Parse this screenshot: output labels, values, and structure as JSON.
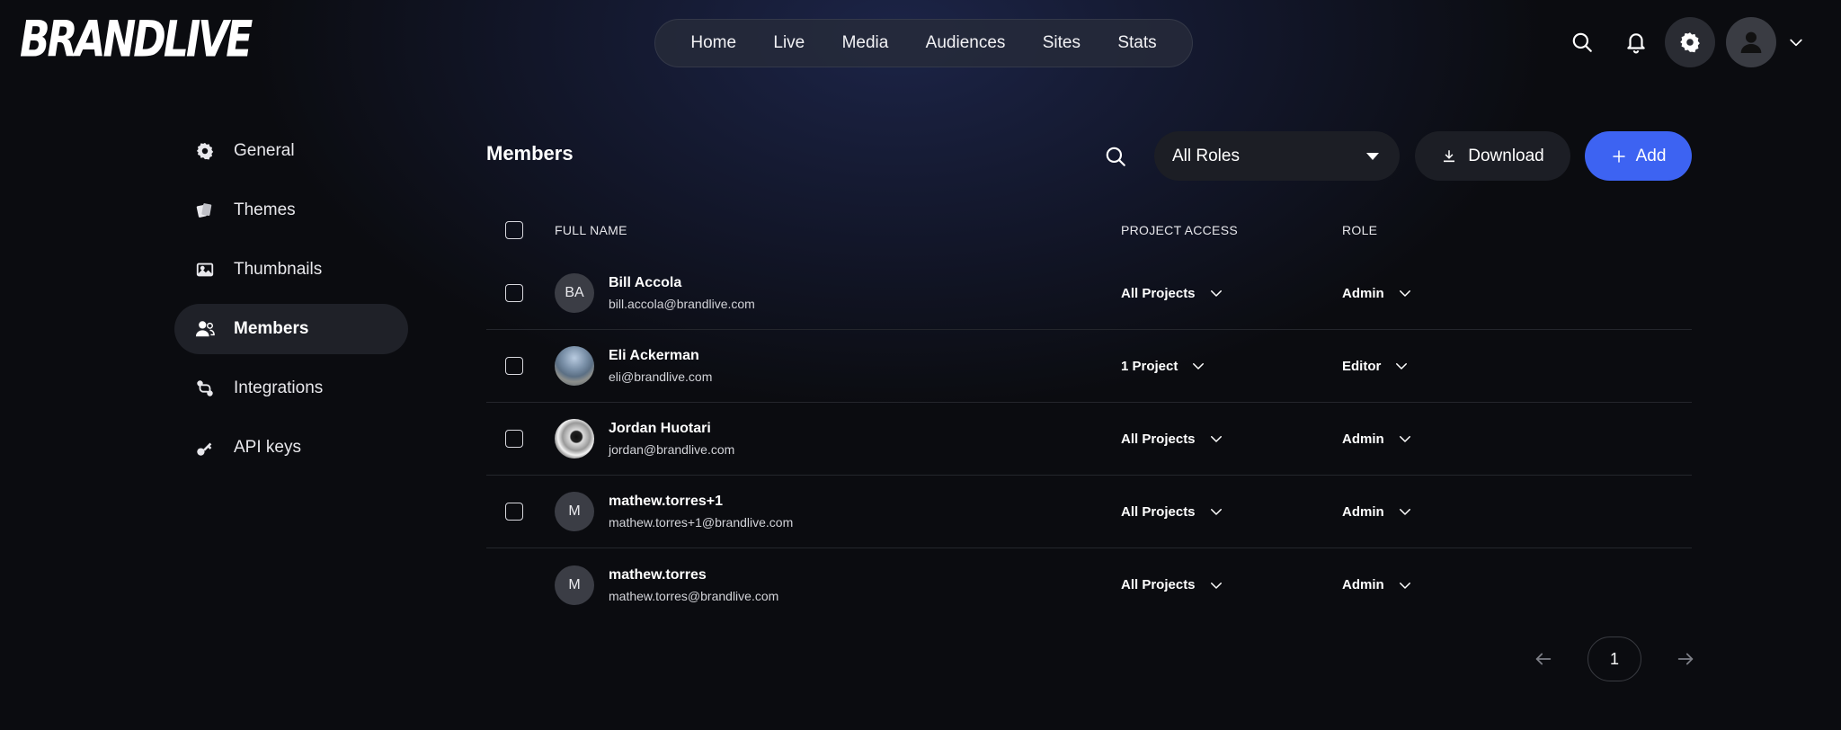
{
  "brand": {
    "logo_text": "BRANDLIVE"
  },
  "topnav": {
    "items": [
      "Home",
      "Live",
      "Media",
      "Audiences",
      "Sites",
      "Stats"
    ]
  },
  "top_actions": {
    "icons": [
      "search-icon",
      "bell-icon",
      "gear-icon",
      "user-icon",
      "chevron-down-icon"
    ]
  },
  "sidebar": {
    "items": [
      {
        "label": "General",
        "icon": "gear-icon",
        "active": false
      },
      {
        "label": "Themes",
        "icon": "cards-icon",
        "active": false
      },
      {
        "label": "Thumbnails",
        "icon": "image-icon",
        "active": false
      },
      {
        "label": "Members",
        "icon": "users-icon",
        "active": true
      },
      {
        "label": "Integrations",
        "icon": "integration-icon",
        "active": false
      },
      {
        "label": "API keys",
        "icon": "key-icon",
        "active": false
      }
    ]
  },
  "main": {
    "title": "Members",
    "roles_filter": "All Roles",
    "download_label": "Download",
    "add_label": "Add"
  },
  "table": {
    "headers": {
      "name": "FULL NAME",
      "access": "PROJECT ACCESS",
      "role": "ROLE"
    },
    "rows": [
      {
        "initials": "BA",
        "name": "Bill Accola",
        "email": "bill.accola@brandlive.com",
        "access": "All Projects",
        "role": "Admin",
        "checkbox": true
      },
      {
        "initials": "",
        "name": "Eli Ackerman",
        "email": "eli@brandlive.com",
        "access": "1 Project",
        "role": "Editor",
        "checkbox": true
      },
      {
        "initials": "",
        "name": "Jordan Huotari",
        "email": "jordan@brandlive.com",
        "access": "All Projects",
        "role": "Admin",
        "checkbox": true
      },
      {
        "initials": "M",
        "name": "mathew.torres+1",
        "email": "mathew.torres+1@brandlive.com",
        "access": "All Projects",
        "role": "Admin",
        "checkbox": true
      },
      {
        "initials": "M",
        "name": "mathew.torres",
        "email": "mathew.torres@brandlive.com",
        "access": "All Projects",
        "role": "Admin",
        "checkbox": false
      }
    ]
  },
  "pagination": {
    "current_page": "1"
  },
  "colors": {
    "accent": "#3d63f2",
    "background": "#0b0c10",
    "surface": "#1c1e25"
  }
}
